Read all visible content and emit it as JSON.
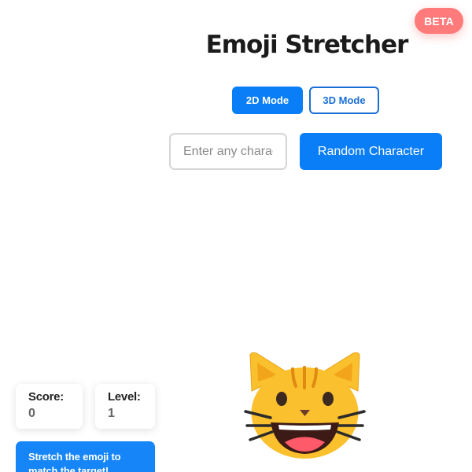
{
  "badge": {
    "label": "BETA",
    "color": "#ff7b7b"
  },
  "header": {
    "title": "Emoji Stretcher"
  },
  "modes": {
    "items": [
      {
        "label": "2D Mode",
        "active": true
      },
      {
        "label": "3D Mode",
        "active": false
      }
    ]
  },
  "character_input": {
    "placeholder": "Enter any character",
    "value": ""
  },
  "random_button": {
    "label": "Random Character"
  },
  "stats": {
    "score": {
      "label": "Score:",
      "value": "0"
    },
    "level": {
      "label": "Level:",
      "value": "1"
    }
  },
  "instructions": {
    "text": "Stretch the emoji to match the target!"
  },
  "emoji": {
    "name": "grinning-cat-icon"
  },
  "colors": {
    "accent": "#0a7ef7",
    "badge": "#ff7b7b",
    "emoji_face": "#fbc02d"
  }
}
